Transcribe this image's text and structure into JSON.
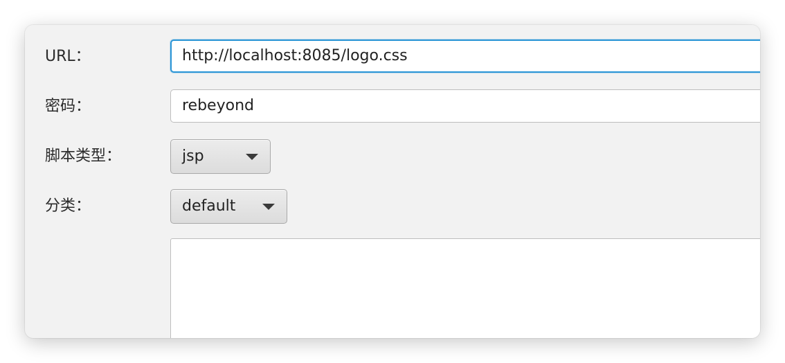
{
  "form": {
    "url_label": "URL：",
    "url_value": "http://localhost:8085/logo.css",
    "password_label": "密码：",
    "password_value": "rebeyond",
    "script_type_label": "脚本类型：",
    "script_type_value": "jsp",
    "category_label": "分类：",
    "category_value": "default",
    "notes_value": ""
  },
  "colors": {
    "window_background": "#f2f2f2",
    "focus_border": "#2a95d6"
  },
  "icons": {
    "combo_arrow": "triangle-down"
  }
}
